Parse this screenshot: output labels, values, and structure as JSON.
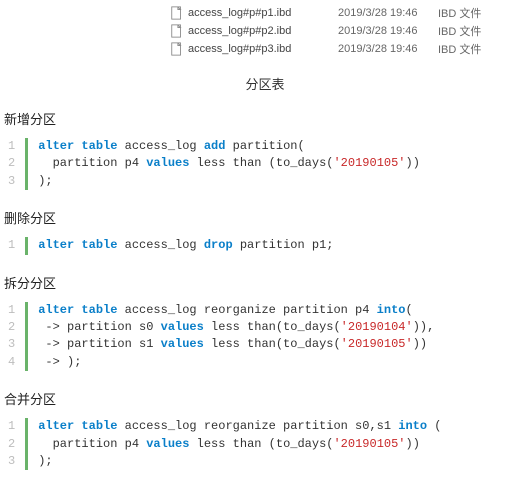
{
  "files": [
    {
      "name": "access_log#p#p1.ibd",
      "date": "2019/3/28 19:46",
      "type": "IBD 文件"
    },
    {
      "name": "access_log#p#p2.ibd",
      "date": "2019/3/28 19:46",
      "type": "IBD 文件"
    },
    {
      "name": "access_log#p#p3.ibd",
      "date": "2019/3/28 19:46",
      "type": "IBD 文件"
    }
  ],
  "caption": "分区表",
  "sections": {
    "add": {
      "title": "新增分区"
    },
    "drop": {
      "title": "删除分区"
    },
    "split": {
      "title": "拆分分区"
    },
    "merge": {
      "title": "合并分区"
    }
  },
  "code": {
    "add": {
      "lines": [
        "1",
        "2",
        "3"
      ],
      "l1_a": "alter table",
      "l1_b": " access_log ",
      "l1_c": "add",
      "l1_d": " partition(",
      "l2_a": "  partition p4 ",
      "l2_b": "values",
      "l2_c": " less than (to_days(",
      "l2_d": "'20190105'",
      "l2_e": "))",
      "l3_a": ");"
    },
    "drop": {
      "lines": [
        "1"
      ],
      "l1_a": "alter table",
      "l1_b": " access_log ",
      "l1_c": "drop",
      "l1_d": " partition p1;"
    },
    "split": {
      "lines": [
        "1",
        "2",
        "3",
        "4"
      ],
      "l1_a": "alter table",
      "l1_b": " access_log reorganize partition p4 ",
      "l1_c": "into",
      "l1_d": "(",
      "l2_a": " -> partition s0 ",
      "l2_b": "values",
      "l2_c": " less than(to_days(",
      "l2_d": "'20190104'",
      "l2_e": ")),",
      "l3_a": " -> partition s1 ",
      "l3_b": "values",
      "l3_c": " less than(to_days(",
      "l3_d": "'20190105'",
      "l3_e": "))",
      "l4_a": " -> );"
    },
    "merge": {
      "lines": [
        "1",
        "2",
        "3"
      ],
      "l1_a": "alter table",
      "l1_b": " access_log reorganize partition s0,s1 ",
      "l1_c": "into",
      "l1_d": " (",
      "l2_a": "  partition p4 ",
      "l2_b": "values",
      "l2_c": " less than (to_days(",
      "l2_d": "'20190105'",
      "l2_e": "))",
      "l3_a": ");"
    }
  }
}
